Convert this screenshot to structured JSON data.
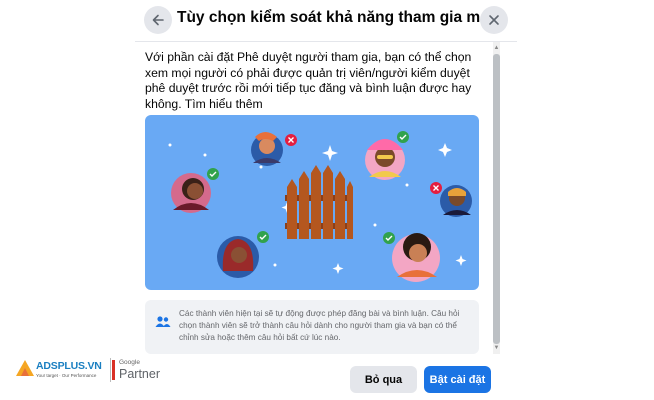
{
  "dialog": {
    "title": "Tùy chọn kiểm soát khả năng tham gia mới",
    "back_icon": "arrow-left-icon",
    "close_icon": "close-icon",
    "description": "Với phần cài đặt Phê duyệt người tham gia, bạn có thể chọn xem mọi người có phải được quản trị viên/người kiểm duyệt phê duyệt trước rồi mới tiếp tục đăng và bình luận được hay không.",
    "learn_more": "Tìm hiểu thêm",
    "note": {
      "icon": "members-icon",
      "text": "Các thành viên hiện tại sẽ tự động được phép đăng bài và bình luận. Câu hỏi chọn thành viên sẽ trở thành câu hỏi dành cho người tham gia và bạn có thể chỉnh sửa hoặc thêm câu hỏi bất cứ lúc nào."
    },
    "buttons": {
      "cancel": "Bỏ qua",
      "enable": "Bật cài đặt"
    },
    "colors": {
      "primary": "#1b74e4",
      "illustration_bg": "#69a9f4",
      "approve": "#31a24c",
      "reject": "#e41e3f"
    }
  },
  "watermark": {
    "brand": "ADSPLUS.VN",
    "tagline": "Your target · Our Performance",
    "google": "Google",
    "partner": "Partner"
  }
}
